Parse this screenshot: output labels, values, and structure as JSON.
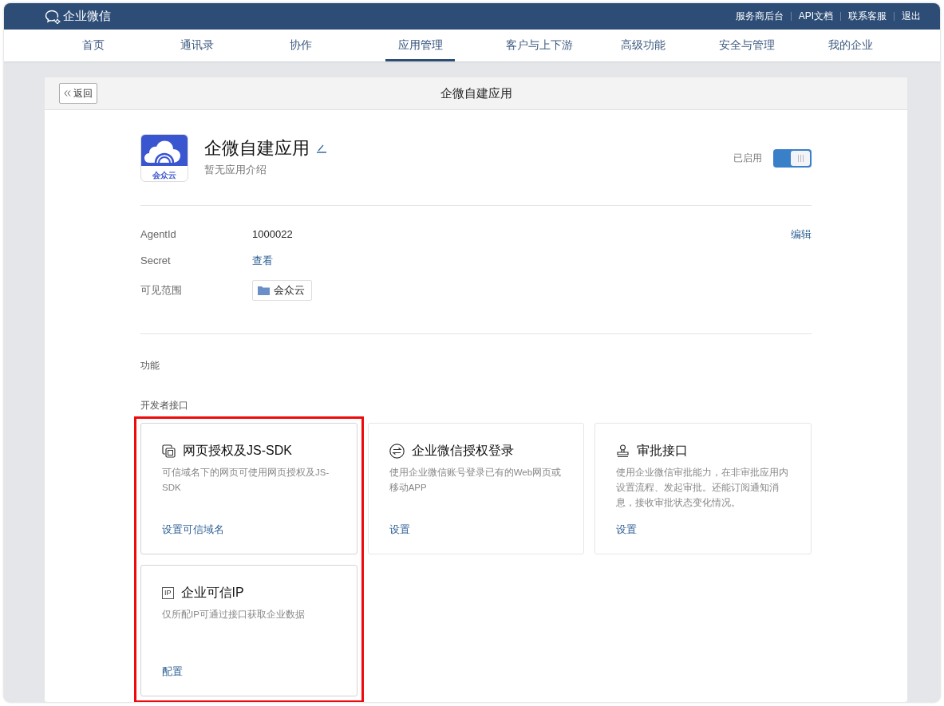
{
  "top_bar": {
    "brand": "企业微信",
    "links": [
      "服务商后台",
      "API文档",
      "联系客服",
      "退出"
    ]
  },
  "nav": [
    {
      "label": "首页",
      "selected": false
    },
    {
      "label": "通讯录",
      "selected": false
    },
    {
      "label": "协作",
      "selected": false
    },
    {
      "label": "应用管理",
      "selected": true
    },
    {
      "label": "客户与上下游",
      "selected": false
    },
    {
      "label": "高级功能",
      "selected": false
    },
    {
      "label": "安全与管理",
      "selected": false
    },
    {
      "label": "我的企业",
      "selected": false
    }
  ],
  "panel": {
    "back_button": "返回",
    "title": "企微自建应用"
  },
  "app": {
    "icon_text": "会众云",
    "name": "企微自建应用",
    "description": "暂无应用介绍",
    "status_label": "已启用",
    "enabled": true
  },
  "details": {
    "edit_link": "编辑",
    "rows": [
      {
        "kind": "text",
        "label": "AgentId",
        "value": "1000022"
      },
      {
        "kind": "link",
        "label": "Secret",
        "value": "查看"
      },
      {
        "kind": "tag",
        "label": "可见范围",
        "value": "会众云"
      }
    ]
  },
  "features_heading": "功能",
  "developer_heading": "开发者接口",
  "cards": [
    {
      "kind": "pages",
      "title": "网页授权及JS-SDK",
      "description": "可信域名下的网页可使用网页授权及JS-SDK",
      "action": "设置可信域名",
      "highlighted": true
    },
    {
      "kind": "exchange",
      "title": "企业微信授权登录",
      "description": "使用企业微信账号登录已有的Web网页或移动APP",
      "action": "设置",
      "highlighted": false
    },
    {
      "kind": "stamp",
      "title": "审批接口",
      "description": "使用企业微信审批能力，在非审批应用内设置流程、发起审批。还能订阅通知消息，接收审批状态变化情况。",
      "action": "设置",
      "highlighted": false
    },
    {
      "kind": "ip",
      "icon_text": "IP",
      "title": "企业可信IP",
      "description": "仅所配IP可通过接口获取企业数据",
      "action": "配置",
      "highlighted": true
    }
  ]
}
